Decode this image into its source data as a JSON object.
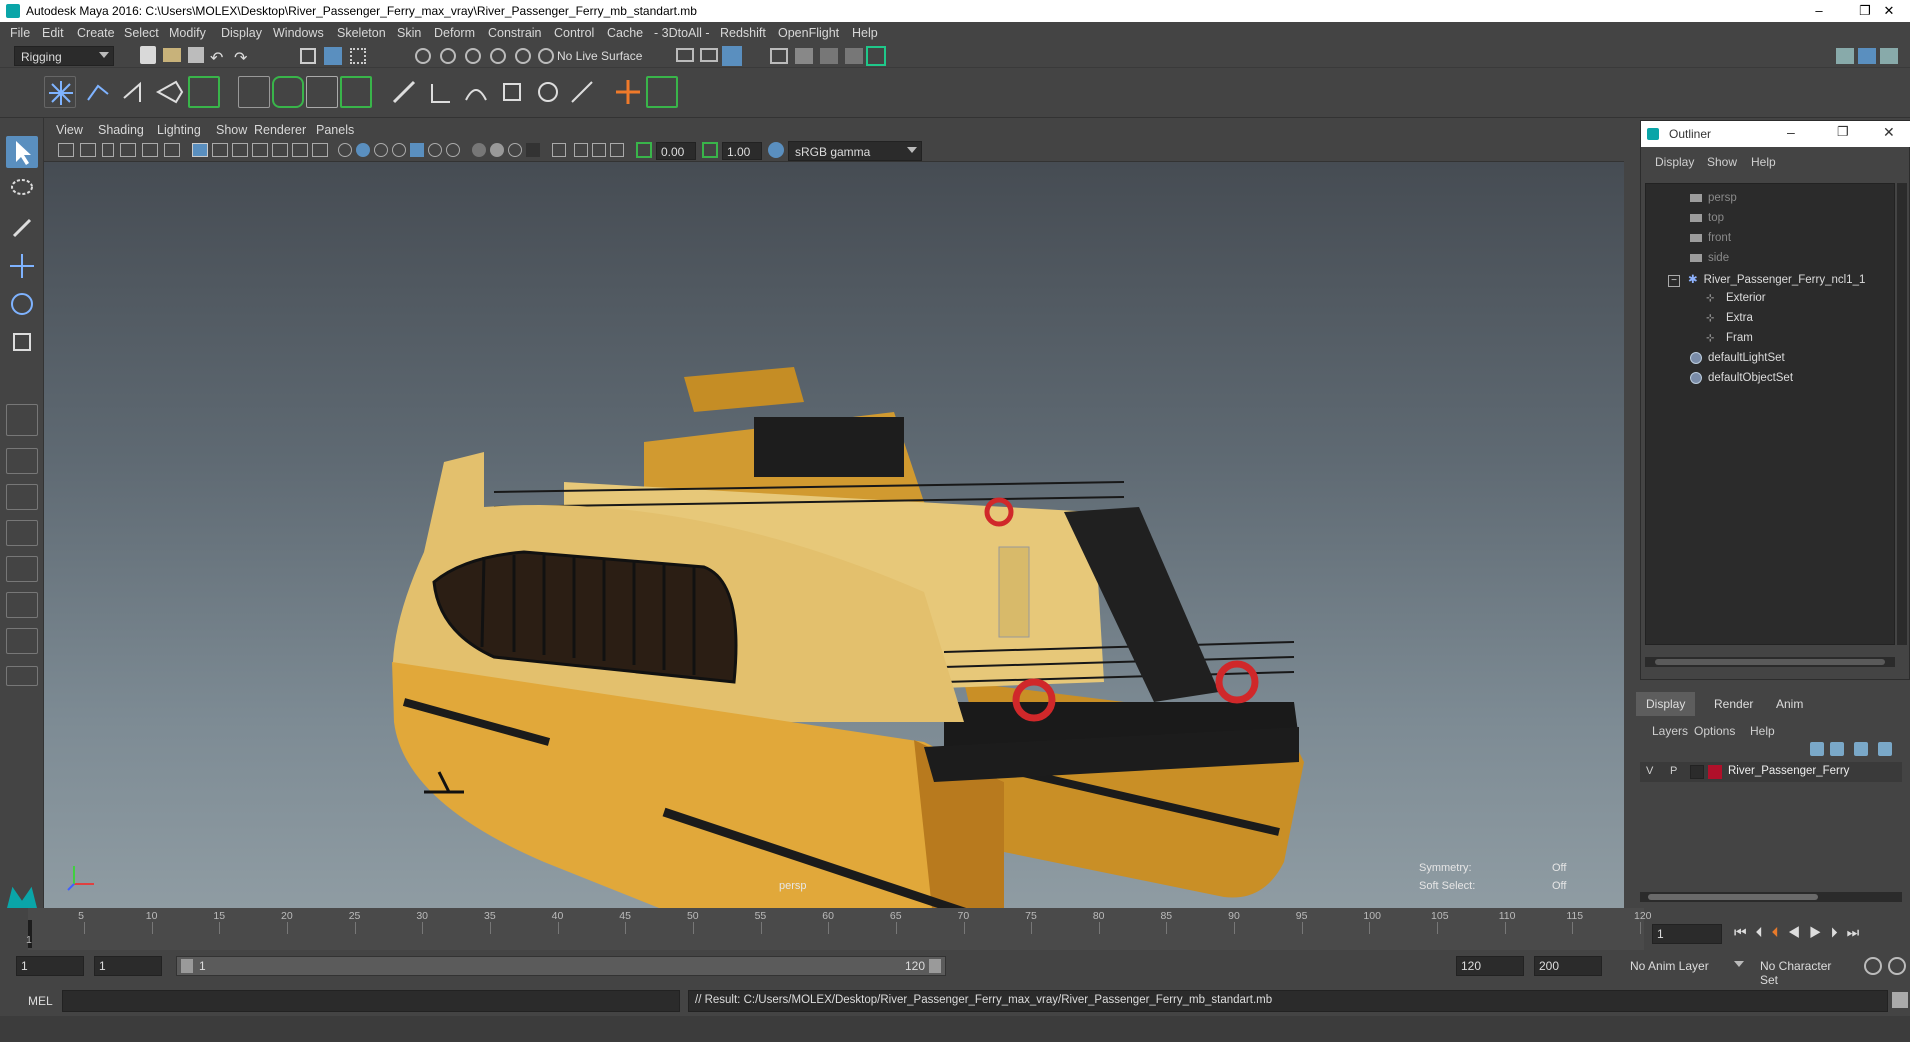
{
  "window": {
    "title": "Autodesk Maya 2016: C:\\Users\\MOLEX\\Desktop\\River_Passenger_Ferry_max_vray\\River_Passenger_Ferry_mb_standart.mb",
    "minimize": "–",
    "restore": "❐",
    "close": "✕"
  },
  "menubar": {
    "items": [
      "File",
      "Edit",
      "Create",
      "Select",
      "Modify",
      "Display",
      "Windows",
      "Skeleton",
      "Skin",
      "Deform",
      "Constrain",
      "Control",
      "Cache",
      "- 3DtoAll -",
      "Redshift",
      "OpenFlight",
      "Help"
    ]
  },
  "statusline": {
    "mode": "Rigging",
    "live_surface": "No Live Surface"
  },
  "panel": {
    "menu": [
      "View",
      "Shading",
      "Lighting",
      "Show",
      "Renderer",
      "Panels"
    ],
    "exposure": "0.00",
    "gamma": "1.00",
    "color_space": "sRGB gamma"
  },
  "viewport": {
    "camera": "persp",
    "symmetry_label": "Symmetry:",
    "symmetry_value": "Off",
    "soft_select_label": "Soft Select:",
    "soft_select_value": "Off"
  },
  "outliner": {
    "title": "Outliner",
    "menu": [
      "Display",
      "Show",
      "Help"
    ],
    "items": [
      {
        "label": "persp",
        "kind": "camera"
      },
      {
        "label": "top",
        "kind": "camera"
      },
      {
        "label": "front",
        "kind": "camera"
      },
      {
        "label": "side",
        "kind": "camera"
      },
      {
        "label": "River_Passenger_Ferry_ncl1_1",
        "kind": "group-root"
      },
      {
        "label": "Exterior",
        "kind": "group"
      },
      {
        "label": "Extra",
        "kind": "group"
      },
      {
        "label": "Fram",
        "kind": "group"
      },
      {
        "label": "defaultLightSet",
        "kind": "set"
      },
      {
        "label": "defaultObjectSet",
        "kind": "set"
      }
    ],
    "collapse_symbol": "−"
  },
  "layer_editor": {
    "tabs": [
      "Display",
      "Render",
      "Anim"
    ],
    "menu": [
      "Layers",
      "Options",
      "Help"
    ],
    "layer": {
      "v": "V",
      "p": "P",
      "name": "River_Passenger_Ferry",
      "color": "#b0102a"
    }
  },
  "timeline": {
    "ticks": [
      "5",
      "10",
      "15",
      "20",
      "25",
      "30",
      "35",
      "40",
      "45",
      "50",
      "55",
      "60",
      "65",
      "70",
      "75",
      "80",
      "85",
      "90",
      "95",
      "100",
      "105",
      "110",
      "115",
      "120"
    ],
    "start_marker": "1",
    "current_frame": "1"
  },
  "range": {
    "start_field": "1",
    "playback_start": "1",
    "slider_start": "1",
    "slider_end": "120",
    "playback_end": "120",
    "end_field": "200",
    "anim_layer": "No Anim Layer",
    "character_set": "No Character Set"
  },
  "command": {
    "lang": "MEL",
    "result": "// Result: C:/Users/MOLEX/Desktop/River_Passenger_Ferry_max_vray/River_Passenger_Ferry_mb_standart.mb"
  },
  "colors": {
    "hull": "#e1a83a",
    "hull_dark": "#b87a1e",
    "accent": "#0aa5a8",
    "layer_red": "#b0102a"
  }
}
